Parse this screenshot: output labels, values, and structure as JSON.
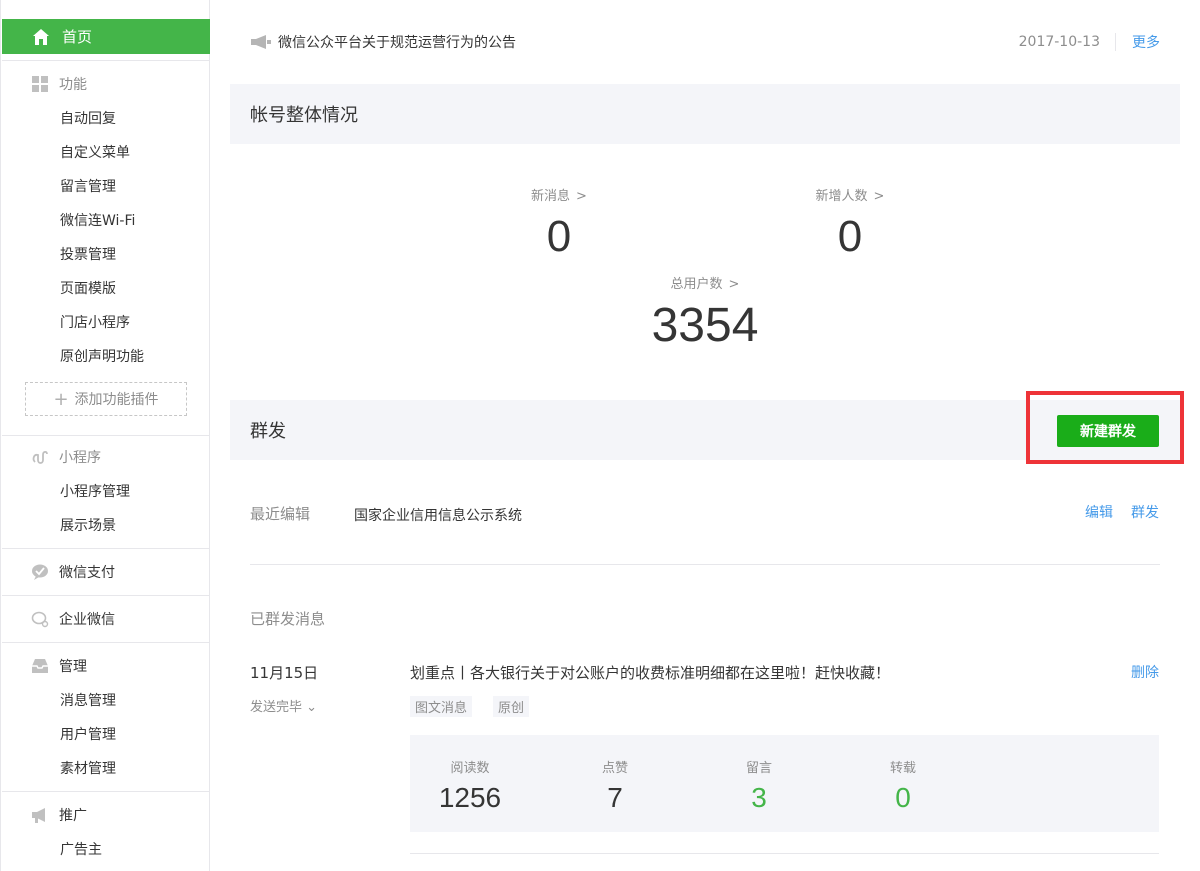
{
  "sidebar": {
    "home": "首页",
    "groups": {
      "functions": "功能",
      "miniprogram": "小程序",
      "wechat_pay": "微信支付",
      "work_wechat": "企业微信",
      "manage": "管理",
      "promote": "推广"
    },
    "function_items": [
      "自动回复",
      "自定义菜单",
      "留言管理",
      "微信连Wi-Fi",
      "投票管理",
      "页面模版",
      "门店小程序",
      "原创声明功能"
    ],
    "add_plugin": "添加功能插件",
    "miniprogram_items": [
      "小程序管理",
      "展示场景"
    ],
    "manage_items": [
      "消息管理",
      "用户管理",
      "素材管理"
    ],
    "promote_items": [
      "广告主"
    ]
  },
  "notice": {
    "text": "微信公众平台关于规范运营行为的公告",
    "date": "2017-10-13",
    "more": "更多"
  },
  "overview": {
    "title": "帐号整体情况",
    "new_messages_label": "新消息",
    "new_messages_value": "0",
    "new_users_label": "新增人数",
    "new_users_value": "0",
    "total_users_label": "总用户数",
    "total_users_value": "3354"
  },
  "broadcast": {
    "title": "群发",
    "new_button": "新建群发",
    "recent_label": "最近编辑",
    "recent_title": "国家企业信用信息公示系统",
    "edit_link": "编辑",
    "send_link": "群发",
    "sent_label": "已群发消息",
    "message": {
      "date": "11月15日",
      "status": "发送完毕",
      "title": "划重点丨各大银行关于对公账户的收费标准明细都在这里啦！赶快收藏！",
      "delete": "删除",
      "tags": [
        "图文消息",
        "原创"
      ],
      "stats": [
        {
          "label": "阅读数",
          "value": "1256"
        },
        {
          "label": "点赞",
          "value": "7"
        },
        {
          "label": "留言",
          "value": "3"
        },
        {
          "label": "转载",
          "value": "0"
        }
      ]
    }
  },
  "colors": {
    "brand_green": "#44b549",
    "button_green": "#1aad19",
    "link_blue": "#459ae9",
    "highlight_red": "#ee3338"
  }
}
